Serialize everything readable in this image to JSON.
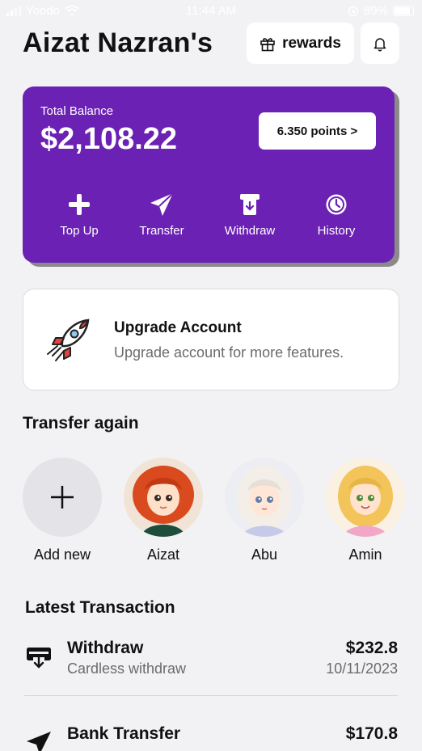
{
  "status_bar": {
    "carrier": "Yoodo",
    "time": "11:44 AM",
    "battery": "89%"
  },
  "header": {
    "title": "Aizat Nazran's",
    "rewards_label": "rewards"
  },
  "balance": {
    "label": "Total Balance",
    "amount": "$2,108.22",
    "points_label": "6.350 points >",
    "actions": [
      {
        "label": "Top Up",
        "icon": "plus-icon"
      },
      {
        "label": "Transfer",
        "icon": "paper-plane-icon"
      },
      {
        "label": "Withdraw",
        "icon": "atm-withdraw-icon"
      },
      {
        "label": "History",
        "icon": "history-clock-icon"
      }
    ]
  },
  "upgrade": {
    "title": "Upgrade Account",
    "subtitle": "Upgrade account for more features.",
    "icon": "rocket-icon"
  },
  "transfer_again": {
    "title": "Transfer again",
    "contacts": [
      {
        "name": "Add new"
      },
      {
        "name": "Aizat"
      },
      {
        "name": "Abu"
      },
      {
        "name": "Amin"
      }
    ]
  },
  "latest_transaction": {
    "title": "Latest Transaction",
    "items": [
      {
        "title": "Withdraw",
        "subtitle": "Cardless withdraw",
        "amount": "$232.8",
        "date": "10/11/2023",
        "icon": "card-withdraw-icon"
      },
      {
        "title": "Bank Transfer",
        "subtitle": "",
        "amount": "$170.8",
        "date": "",
        "icon": "paper-plane-icon"
      }
    ]
  },
  "colors": {
    "accent": "#6b21b3",
    "background": "#f2f2f4"
  }
}
